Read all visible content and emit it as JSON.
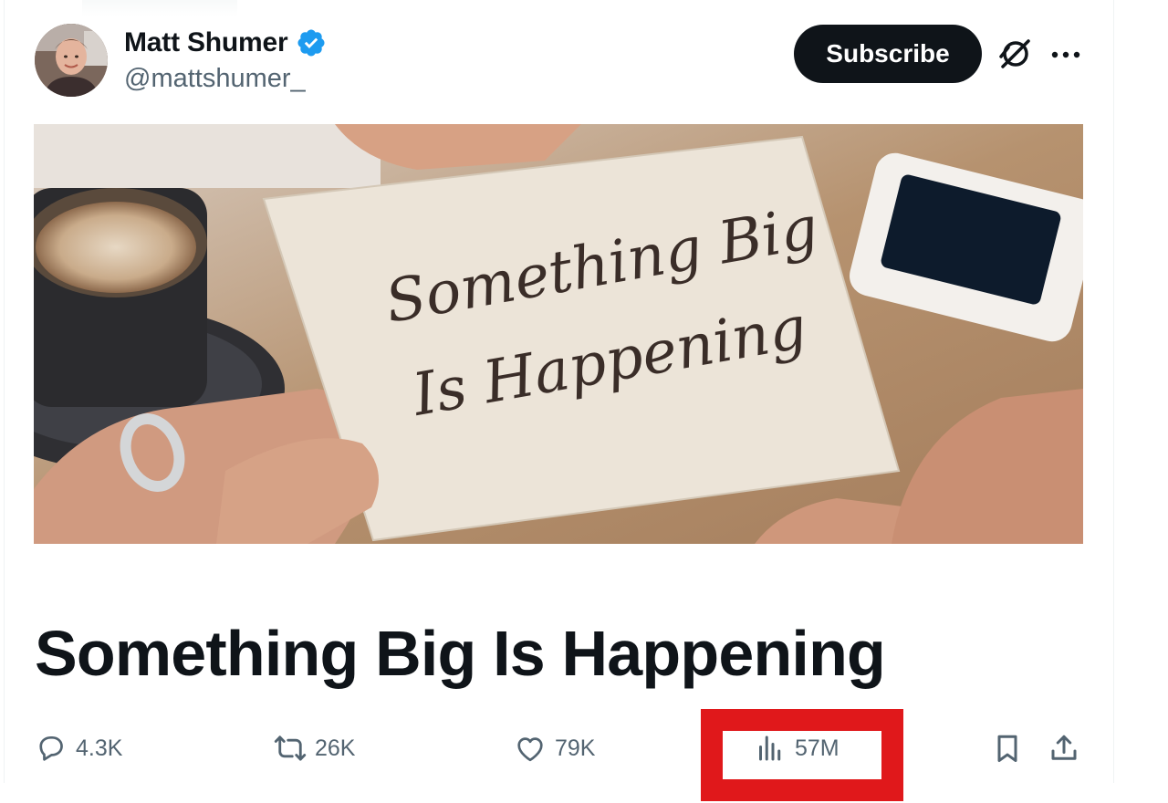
{
  "author": {
    "name": "Matt Shumer",
    "handle": "@mattshumer_",
    "verified": true
  },
  "header": {
    "subscribe_label": "Subscribe",
    "more_label": "···"
  },
  "cover": {
    "card_line_1": "Something Big",
    "card_line_2": "Is Happening"
  },
  "article": {
    "title": "Something Big Is Happening"
  },
  "actions": {
    "replies": "4.3K",
    "reposts": "26K",
    "likes": "79K",
    "views": "57M"
  },
  "colors": {
    "text_primary": "#0f1419",
    "text_secondary": "#536471",
    "verified_blue": "#1d9bf0",
    "highlight_red": "#e0181b"
  },
  "icons": [
    "verified-badge-icon",
    "grok-icon",
    "more-icon",
    "reply-icon",
    "repost-icon",
    "like-icon",
    "views-icon",
    "bookmark-icon",
    "share-icon"
  ]
}
